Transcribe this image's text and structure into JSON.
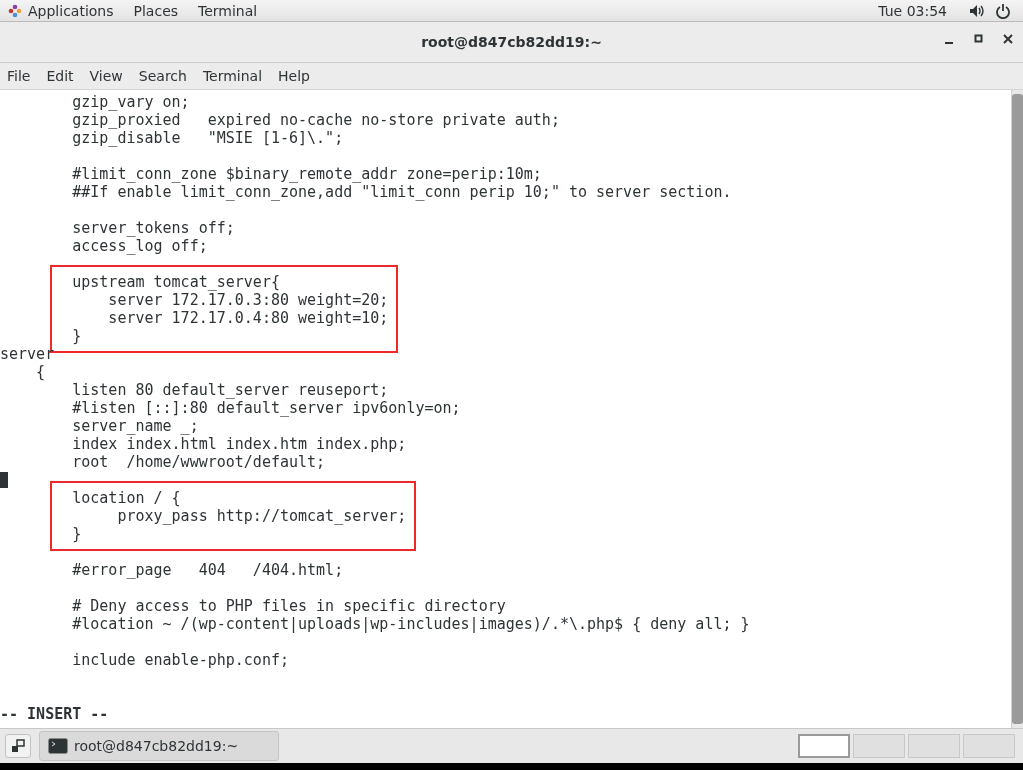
{
  "top_panel": {
    "menus": [
      "Applications",
      "Places",
      "Terminal"
    ],
    "clock": "Tue 03:54"
  },
  "window": {
    "title": "root@d847cb82dd19:~"
  },
  "menu_bar": [
    "File",
    "Edit",
    "View",
    "Search",
    "Terminal",
    "Help"
  ],
  "terminal": {
    "blocks": [
      {
        "highlighted": false,
        "lines": [
          {
            "kind": "code",
            "text": "        gzip_vary on;",
            "cursor": false
          },
          {
            "kind": "code",
            "text": "        gzip_proxied   expired no-cache no-store private auth;",
            "cursor": false
          },
          {
            "kind": "code",
            "text": "        gzip_disable   \"MSIE [1-6]\\.\";",
            "cursor": false
          },
          {
            "kind": "blank",
            "cursor": false
          },
          {
            "kind": "code",
            "text": "        #limit_conn_zone $binary_remote_addr zone=perip:10m;",
            "cursor": false
          },
          {
            "kind": "code",
            "text": "        ##If enable limit_conn_zone,add \"limit_conn perip 10;\" to server section.",
            "cursor": false
          },
          {
            "kind": "blank",
            "cursor": false
          },
          {
            "kind": "code",
            "text": "        server_tokens off;",
            "cursor": false
          },
          {
            "kind": "code",
            "text": "        access_log off;",
            "cursor": false
          },
          {
            "kind": "blank",
            "cursor": false
          }
        ]
      },
      {
        "highlighted": true,
        "lines": [
          {
            "kind": "code",
            "text": "        upstream tomcat_server{",
            "cursor": false
          },
          {
            "kind": "code",
            "text": "            server 172.17.0.3:80 weight=20;",
            "cursor": false
          },
          {
            "kind": "code",
            "text": "            server 172.17.0.4:80 weight=10;",
            "cursor": false
          },
          {
            "kind": "code",
            "text": "        }",
            "cursor": false
          }
        ]
      },
      {
        "highlighted": false,
        "lines": [
          {
            "kind": "code",
            "text": "server",
            "cursor": false
          },
          {
            "kind": "code",
            "text": "    {",
            "cursor": false
          },
          {
            "kind": "code",
            "text": "        listen 80 default_server reuseport;",
            "cursor": false
          },
          {
            "kind": "code",
            "text": "        #listen [::]:80 default_server ipv6only=on;",
            "cursor": false
          },
          {
            "kind": "code",
            "text": "        server_name _;",
            "cursor": false
          },
          {
            "kind": "code",
            "text": "        index index.html index.htm index.php;",
            "cursor": false
          },
          {
            "kind": "code",
            "text": "        root  /home/wwwroot/default;",
            "cursor": false
          },
          {
            "kind": "blank",
            "cursor": true
          }
        ]
      },
      {
        "highlighted": true,
        "lines": [
          {
            "kind": "code",
            "text": "        location / {",
            "cursor": false
          },
          {
            "kind": "code",
            "text": "             proxy_pass http://tomcat_server;",
            "cursor": false
          },
          {
            "kind": "code",
            "text": "        }",
            "cursor": false
          }
        ]
      },
      {
        "highlighted": false,
        "lines": [
          {
            "kind": "blank",
            "cursor": false
          },
          {
            "kind": "code",
            "text": "        #error_page   404   /404.html;",
            "cursor": false
          },
          {
            "kind": "blank",
            "cursor": false
          },
          {
            "kind": "code",
            "text": "        # Deny access to PHP files in specific directory",
            "cursor": false
          },
          {
            "kind": "code",
            "text": "        #location ~ /(wp-content|uploads|wp-includes|images)/.*\\.php$ { deny all; }",
            "cursor": false
          },
          {
            "kind": "blank",
            "cursor": false
          },
          {
            "kind": "code",
            "text": "        include enable-php.conf;",
            "cursor": false
          },
          {
            "kind": "blank",
            "cursor": false
          },
          {
            "kind": "blank",
            "cursor": false
          }
        ]
      }
    ],
    "mode_line": "-- INSERT --"
  },
  "taskbar": {
    "windows": [
      {
        "label": "root@d847cb82dd19:~",
        "selected": false
      }
    ],
    "workspaces": [
      {
        "selected": true
      },
      {
        "selected": false
      },
      {
        "selected": false
      },
      {
        "selected": false
      }
    ]
  }
}
